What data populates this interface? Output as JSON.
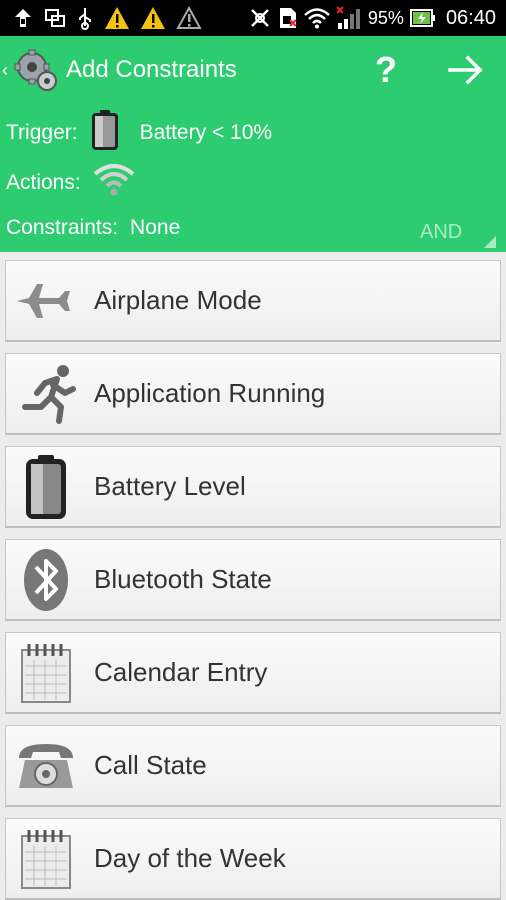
{
  "status_bar": {
    "battery_percent": "95%",
    "time": "06:40"
  },
  "action_bar": {
    "title": "Add Constraints",
    "help_label": "?"
  },
  "summary": {
    "trigger_label": "Trigger:",
    "trigger_value": "Battery < 10%",
    "actions_label": "Actions:",
    "constraints_label": "Constraints:",
    "constraints_value": "None",
    "logic_button": "AND"
  },
  "constraints": [
    {
      "label": "Airplane Mode",
      "icon": "airplane-icon"
    },
    {
      "label": "Application Running",
      "icon": "running-person-icon"
    },
    {
      "label": "Battery Level",
      "icon": "battery-icon"
    },
    {
      "label": "Bluetooth State",
      "icon": "bluetooth-icon"
    },
    {
      "label": "Calendar Entry",
      "icon": "calendar-icon"
    },
    {
      "label": "Call State",
      "icon": "telephone-icon"
    },
    {
      "label": "Day of the Week",
      "icon": "calendar-icon"
    }
  ],
  "colors": {
    "accent": "#2ecc71",
    "status_bar": "#000000",
    "list_bg": "#ececec",
    "text": "#333333"
  }
}
